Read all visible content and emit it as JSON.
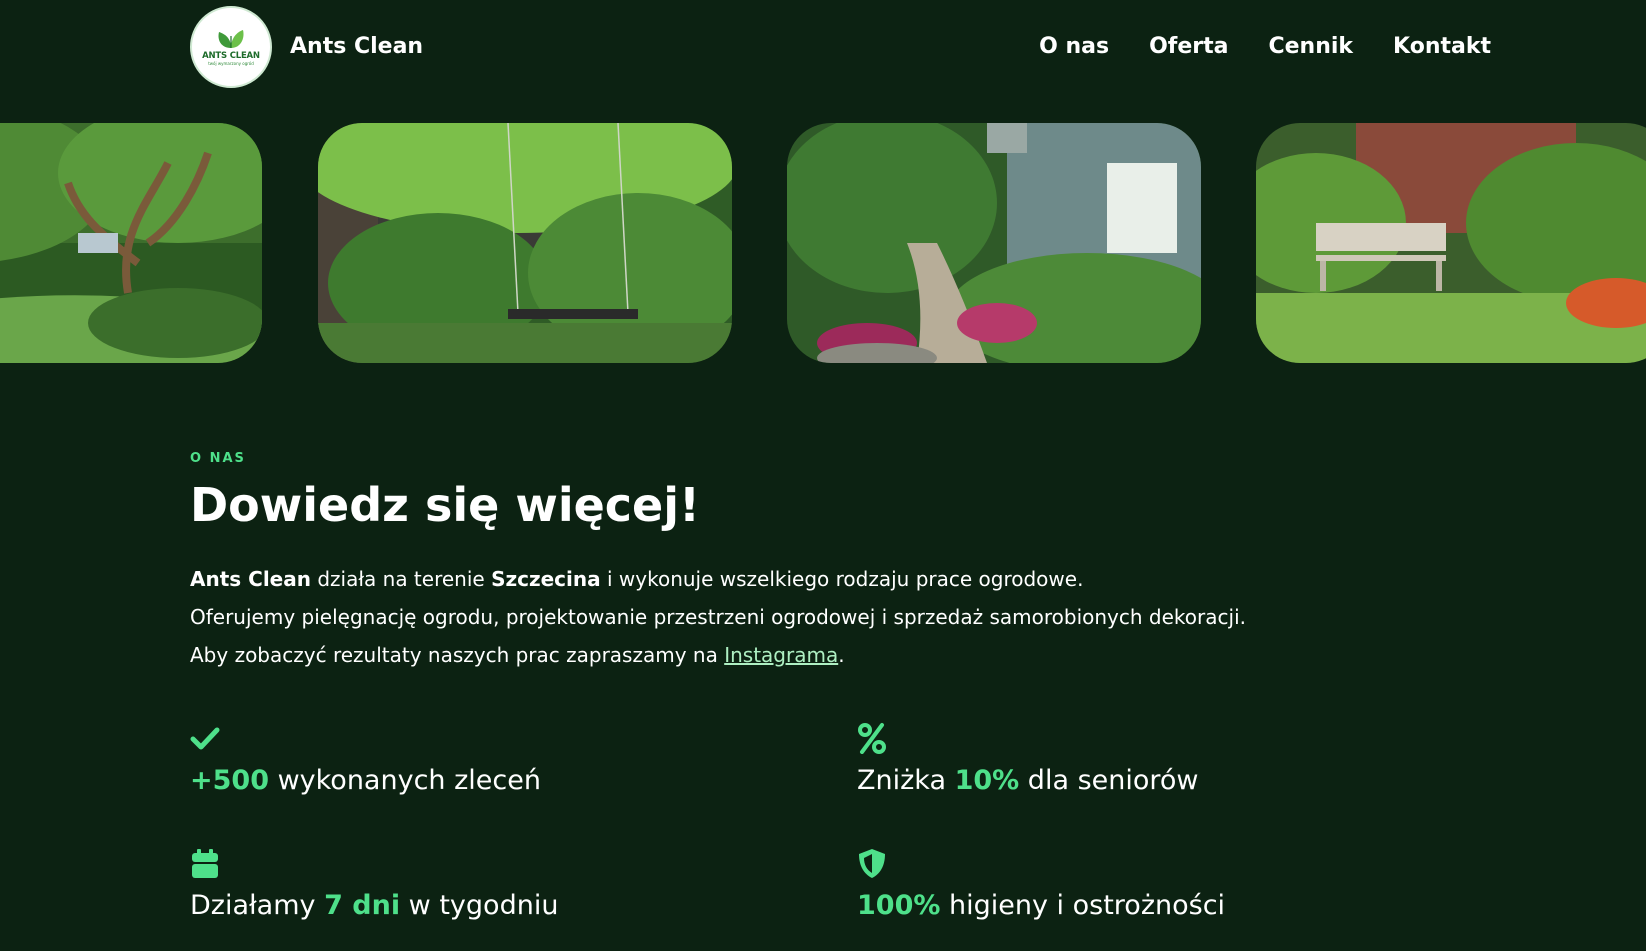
{
  "header": {
    "logo_text": "ANTS CLEAN",
    "logo_subtext": "twój wymarzony ogród",
    "brand": "Ants Clean",
    "nav": [
      "O nas",
      "Oferta",
      "Cennik",
      "Kontakt"
    ]
  },
  "gallery": [
    {
      "name": "garden-tree-lawn-photo"
    },
    {
      "name": "garden-swing-photo"
    },
    {
      "name": "garden-path-house-photo"
    },
    {
      "name": "garden-bench-photo"
    }
  ],
  "about": {
    "eyebrow": "O NAS",
    "heading": "Dowiedz się więcej!",
    "line1": {
      "company": "Ants Clean",
      "part1": " działa na terenie ",
      "city": "Szczecina",
      "part2": " i wykonuje wszelkiego rodzaju prace ogrodowe."
    },
    "line2": "Oferujemy pielęgnację ogrodu, projektowanie przestrzeni ogrodowej i sprzedaż samorobionych dekoracji.",
    "line3": {
      "prefix": "Aby zobaczyć rezultaty naszych prac zapraszamy na ",
      "link": "Instagrama",
      "suffix": "."
    }
  },
  "features": {
    "orders": {
      "icon": "check-icon",
      "highlight": "+500",
      "text": " wykonanych zleceń"
    },
    "discount": {
      "icon": "percent-icon",
      "prefix": "Zniżka ",
      "highlight": "10%",
      "suffix": " dla seniorów"
    },
    "days": {
      "icon": "calendar-icon",
      "prefix": "Działamy ",
      "highlight": "7 dni",
      "suffix": " w tygodniu"
    },
    "hygiene": {
      "icon": "shield-icon",
      "highlight": "100%",
      "suffix": " higieny i ostrożności"
    }
  },
  "colors": {
    "background": "#0c2212",
    "accent": "#4ee08a",
    "text": "#ffffff",
    "link": "#aef0c2"
  }
}
